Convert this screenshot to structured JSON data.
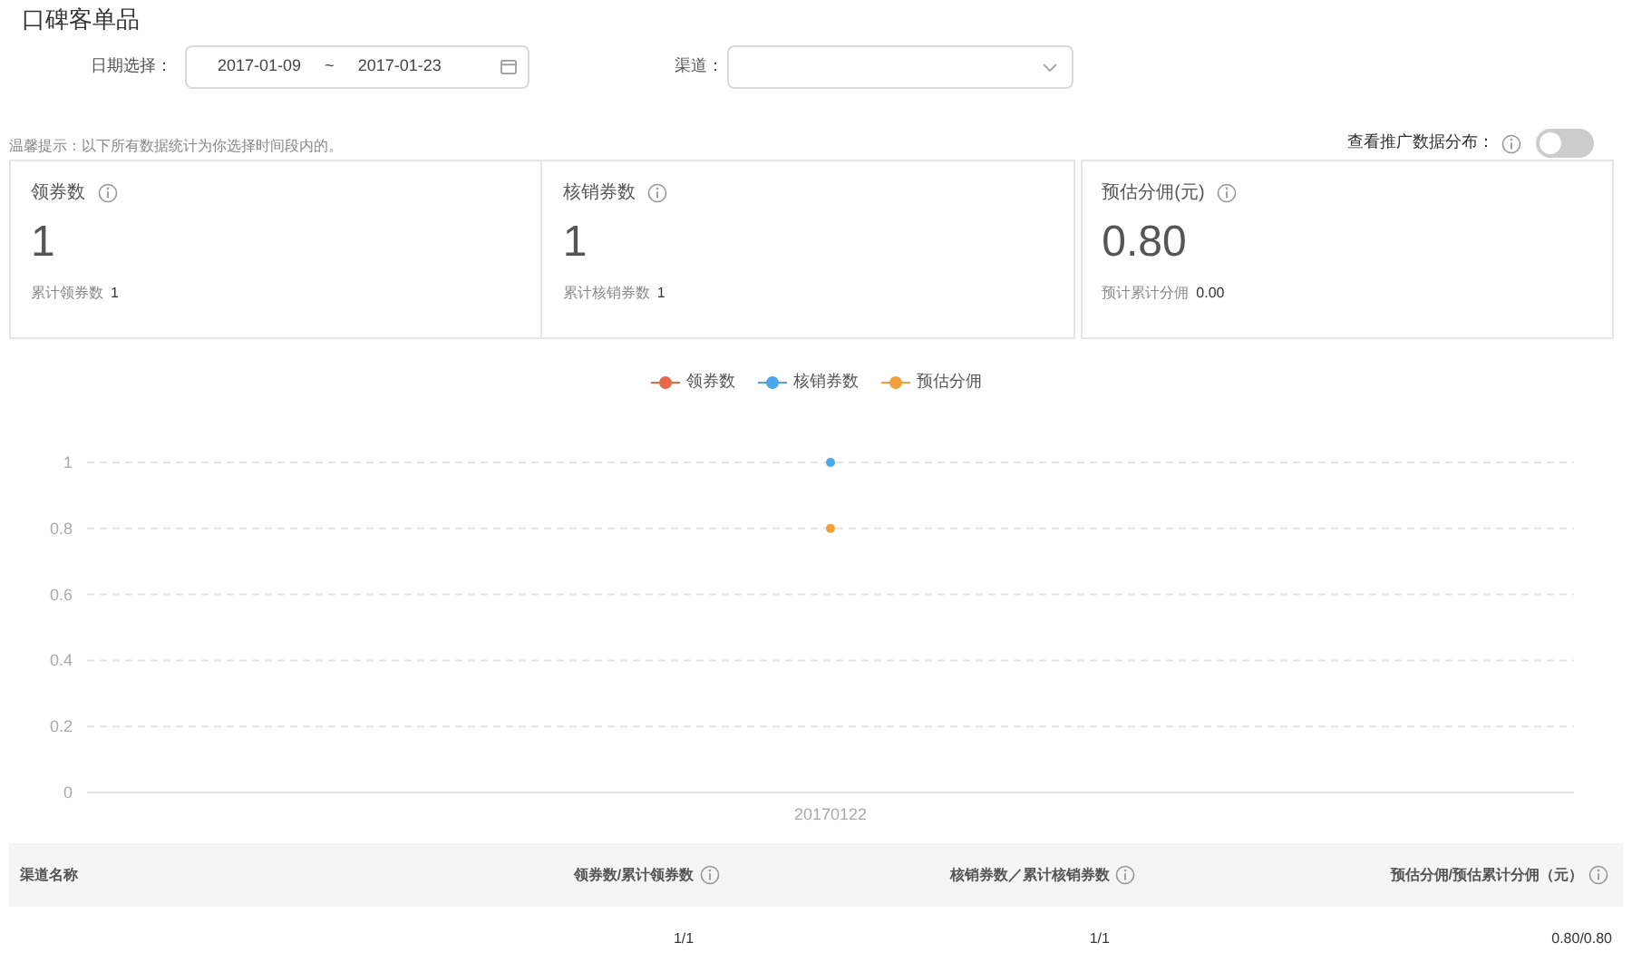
{
  "title": "口碑客单品",
  "filters": {
    "date_label": "日期选择：",
    "date_start": "2017-01-09",
    "date_separator": "~",
    "date_end": "2017-01-23",
    "channel_label": "渠道："
  },
  "hint": "温馨提示：以下所有数据统计为你选择时间段内的。",
  "promo_toggle": {
    "label": "查看推广数据分布：",
    "on": false
  },
  "cards": [
    {
      "title": "领券数",
      "value": "1",
      "sub_label": "累计领券数",
      "sub_value": "1"
    },
    {
      "title": "核销券数",
      "value": "1",
      "sub_label": "累计核销券数",
      "sub_value": "1"
    },
    {
      "title": "预估分佣(元)",
      "value": "0.80",
      "sub_label": "预计累计分佣",
      "sub_value": "0.00"
    }
  ],
  "chart": {
    "chart_data": {
      "type": "line",
      "grid": true,
      "legend": "top",
      "categories": [
        "20170122"
      ],
      "ylim": [
        0,
        1
      ],
      "yticks": [
        0,
        0.2,
        0.4,
        0.6,
        0.8,
        1
      ],
      "series": [
        {
          "name": "领券数",
          "color": "#e8684a",
          "marker": "circle",
          "values": [
            null
          ]
        },
        {
          "name": "核销券数",
          "color": "#4aa8e8",
          "marker": "circle",
          "values": [
            1
          ]
        },
        {
          "name": "预估分佣",
          "color": "#f0a03c",
          "marker": "circle",
          "values": [
            0.8
          ]
        }
      ]
    }
  },
  "table": {
    "columns": [
      "渠道名称",
      "领券数/累计领券数",
      "核销券数／累计核销券数",
      "预估分佣/预估累计分佣（元）"
    ],
    "rows": [
      [
        "",
        "1/1",
        "1/1",
        "0.80/0.80"
      ]
    ]
  }
}
